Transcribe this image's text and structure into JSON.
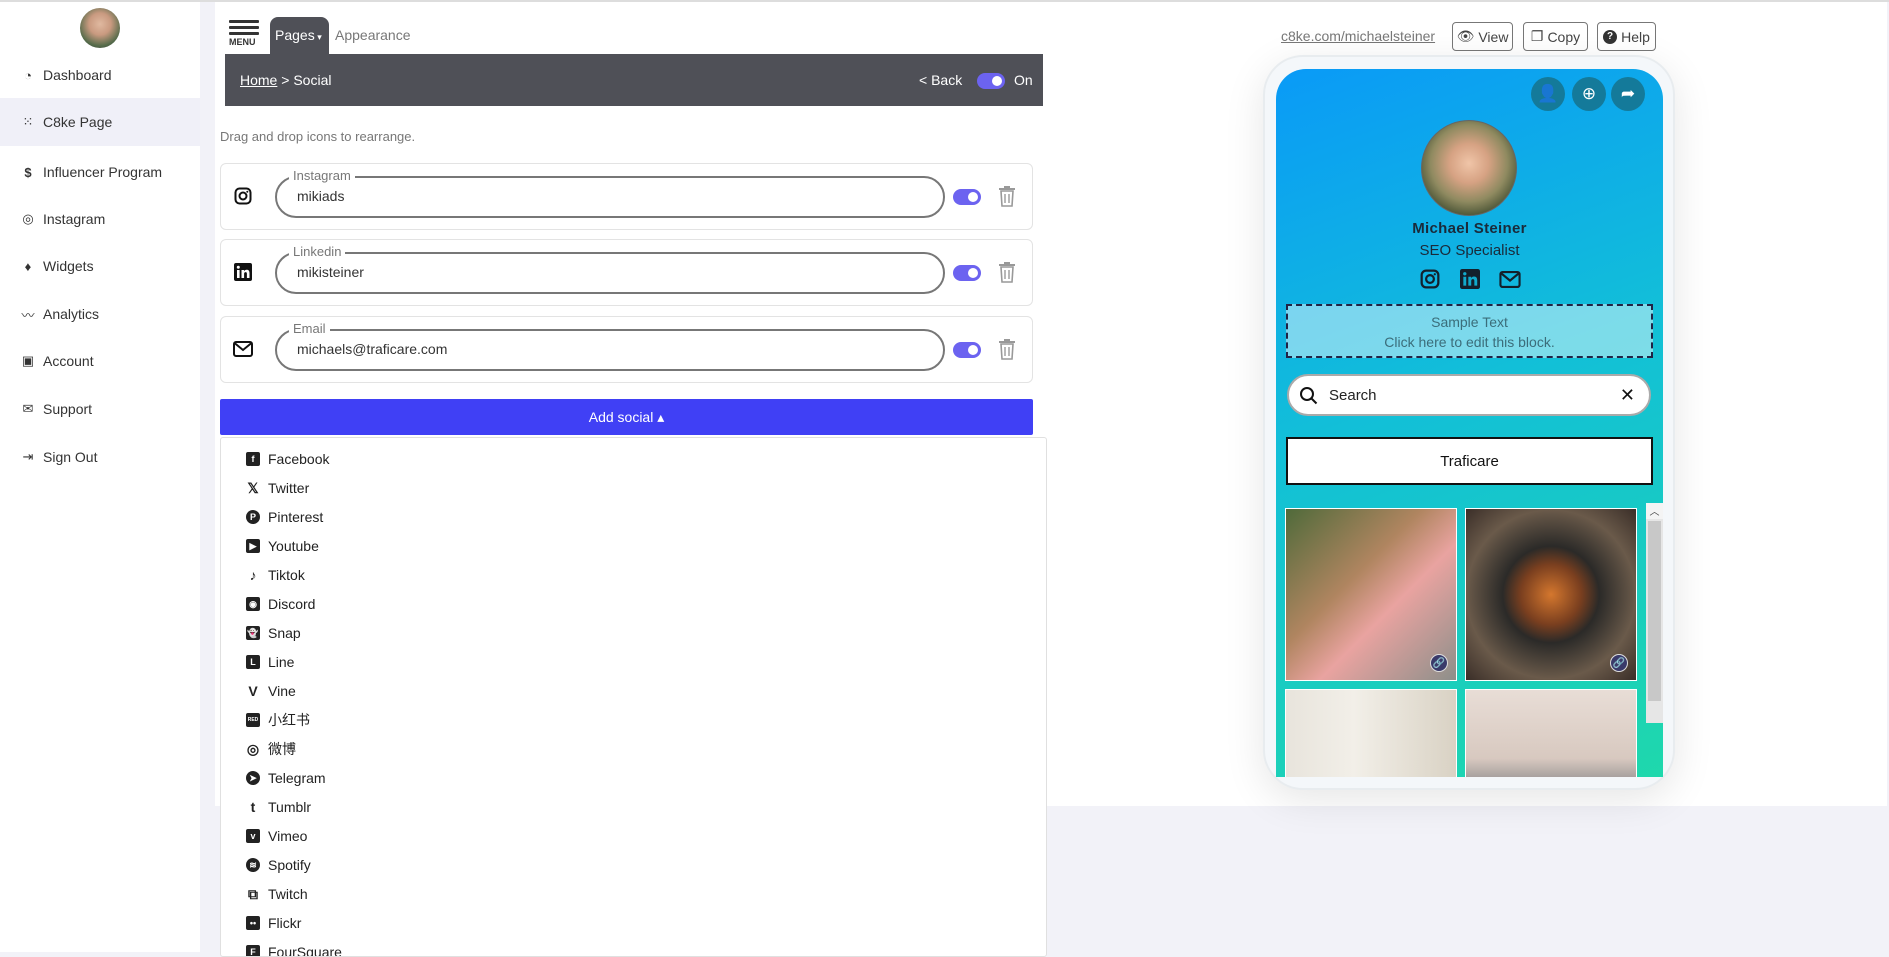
{
  "sidebar": {
    "items": [
      {
        "label": "Dashboard",
        "icon": "gauge-icon"
      },
      {
        "label": "C8ke Page",
        "icon": "grid-icon",
        "active": true
      },
      {
        "label": "Influencer Program",
        "icon": "dollar-icon"
      },
      {
        "label": "Instagram",
        "icon": "instagram-icon"
      },
      {
        "label": "Widgets",
        "icon": "gem-icon"
      },
      {
        "label": "Analytics",
        "icon": "chart-line-icon"
      },
      {
        "label": "Account",
        "icon": "id-card-icon"
      },
      {
        "label": "Support",
        "icon": "envelope-icon"
      },
      {
        "label": "Sign Out",
        "icon": "sign-out-icon"
      }
    ]
  },
  "header": {
    "menu_label": "MENU",
    "tabs": {
      "pages": "Pages",
      "appearance": "Appearance"
    }
  },
  "breadcrumb": {
    "home": "Home",
    "sep": " > ",
    "current": "Social"
  },
  "bar": {
    "back": "< Back",
    "toggle_label": "On",
    "toggle_on": true
  },
  "hint": "Drag and drop icons to rearrange.",
  "socials": [
    {
      "label": "Instagram",
      "value": "mikiads",
      "enabled": true
    },
    {
      "label": "Linkedin",
      "value": "mikisteiner",
      "enabled": true
    },
    {
      "label": "Email",
      "value": "michaels@traficare.com",
      "enabled": true
    }
  ],
  "add_social": "Add social ▴",
  "dropdown": [
    "Facebook",
    "Twitter",
    "Pinterest",
    "Youtube",
    "Tiktok",
    "Discord",
    "Snap",
    "Line",
    "Vine",
    "小红书",
    "微博",
    "Telegram",
    "Tumblr",
    "Vimeo",
    "Spotify",
    "Twitch",
    "Flickr",
    "FourSquare"
  ],
  "preview": {
    "url": "c8ke.com/michaelsteiner",
    "buttons": {
      "view": "View",
      "copy": "Copy",
      "help": "Help"
    },
    "name": "Michael Steiner",
    "title": "SEO Specialist",
    "sample_line1": "Sample Text",
    "sample_line2": "Click here to edit this block.",
    "search_placeholder": "Search",
    "link_button": "Traficare"
  },
  "colors": {
    "accent": "#4040f5",
    "toggle": "#6c63f0",
    "dark_bar": "#4f5057",
    "gradient_start": "#0a9af7",
    "gradient_end": "#1fd8ac"
  }
}
